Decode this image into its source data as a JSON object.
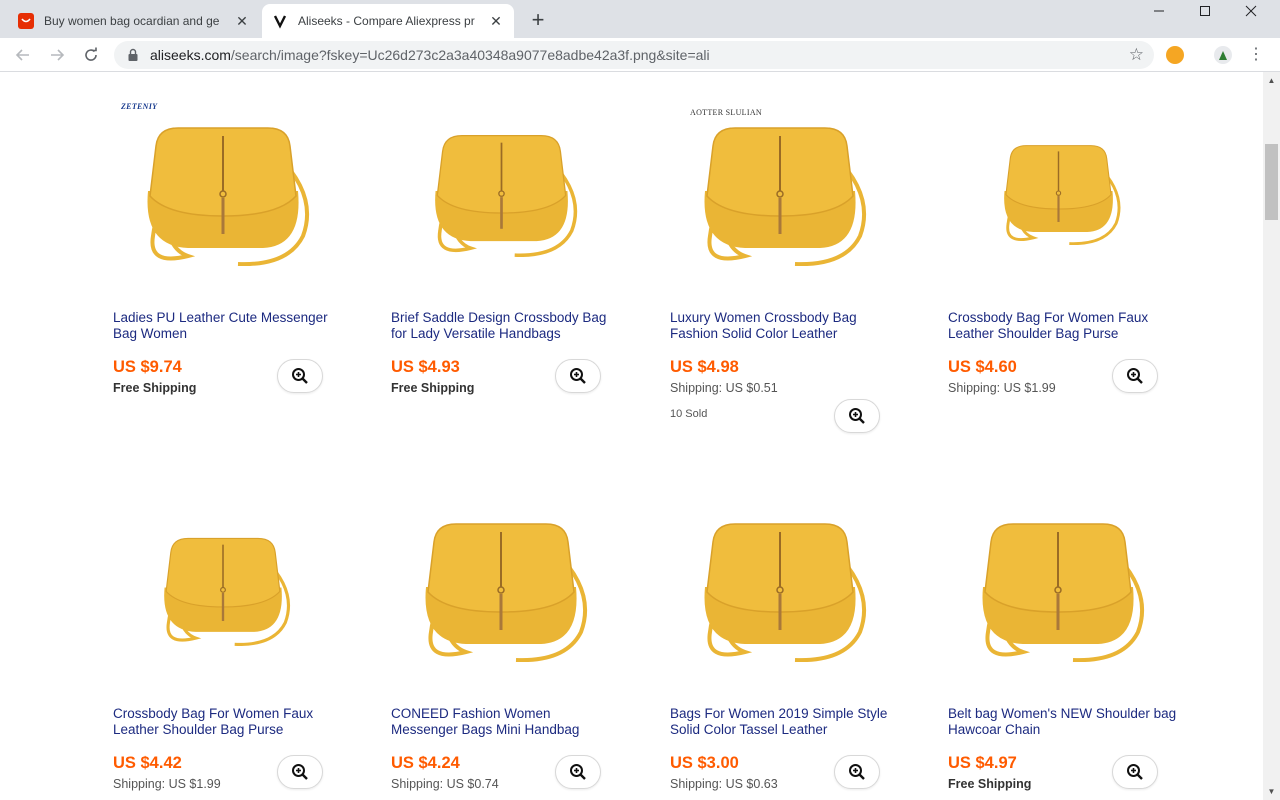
{
  "browser": {
    "tabs": [
      {
        "title": "Buy women bag ocardian and ge",
        "state": "inactive",
        "favicon": "aliexpress-icon"
      },
      {
        "title": "Aliseeks - Compare Aliexpress pr",
        "state": "active",
        "favicon": "aliseeks-icon"
      }
    ],
    "url_host": "aliseeks.com",
    "url_path": "/search/image?fskey=Uc26d273c2a3a40348a9077e8adbe42a3f.png&site=ali"
  },
  "products": [
    {
      "title": "Ladies PU Leather Cute Messenger Bag Women",
      "price": "US $9.74",
      "shipping": "Free Shipping",
      "free": true,
      "sold": "",
      "brand": "ZETENIY"
    },
    {
      "title": "Brief Saddle Design Crossbody Bag for Lady Versatile Handbags",
      "price": "US $4.93",
      "shipping": "Free Shipping",
      "free": true,
      "sold": "",
      "brand": ""
    },
    {
      "title": "Luxury Women Crossbody Bag Fashion Solid Color Leather",
      "price": "US $4.98",
      "shipping": "Shipping: US $0.51",
      "free": false,
      "sold": "10 Sold",
      "brand": "AOTTER SLULIAN"
    },
    {
      "title": "Crossbody Bag For Women Faux Leather Shoulder Bag Purse",
      "price": "US $4.60",
      "shipping": "Shipping: US $1.99",
      "free": false,
      "sold": "",
      "brand": ""
    },
    {
      "title": "Crossbody Bag For Women Faux Leather Shoulder Bag Purse",
      "price": "US $4.42",
      "shipping": "Shipping: US $1.99",
      "free": false,
      "sold": "",
      "brand": ""
    },
    {
      "title": "CONEED Fashion Women Messenger Bags Mini Handbag",
      "price": "US $4.24",
      "shipping": "Shipping: US $0.74",
      "free": false,
      "sold": "",
      "brand": ""
    },
    {
      "title": "Bags For Women 2019 Simple Style Solid Color Tassel Leather",
      "price": "US $3.00",
      "shipping": "Shipping: US $0.63",
      "free": false,
      "sold": "",
      "brand": ""
    },
    {
      "title": "Belt bag Women's NEW Shoulder bag Hawcoar Chain",
      "price": "US $4.97",
      "shipping": "Free Shipping",
      "free": true,
      "sold": "",
      "brand": ""
    }
  ],
  "colors": {
    "price": "#ff5b00",
    "title_link": "#1c2a80",
    "bag": "#eab535"
  }
}
